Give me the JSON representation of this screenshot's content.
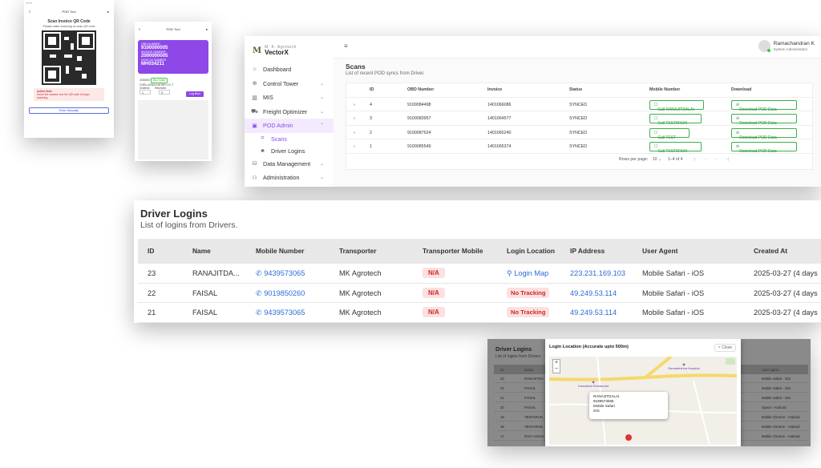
{
  "phone1": {
    "app_name": "POD Tool",
    "title": "Scan Invoice QR Code",
    "subtitle": "Please make scanning on scan QR code",
    "warning_title": "Action Note:",
    "warning_text": "Hover the camera over the QR code to begin scanning.",
    "enter_manually": "Enter Manually"
  },
  "phone2": {
    "app_name": "POD Tool",
    "card": {
      "l1": "OBD NUMBER",
      "v1": "9100000005",
      "l2": "INVOICE NUMBER",
      "v2": "2000000005",
      "l3": "VEHICLE NUMBER",
      "v3": "MH034211"
    },
    "info_id": "2000000",
    "badge": "Box Code",
    "company": "CHELLASWI KATHIR CO, T",
    "box_label_1": "Ordered",
    "box_label_2": "Received",
    "box_val_1": "1",
    "box_val_2": "0",
    "action": "Log Bind"
  },
  "vectorx": {
    "brand_top": "M. K. Agrotech",
    "brand": "VectorX",
    "user_name": "Ramachandran K",
    "user_role": "System Administrator",
    "nav": [
      {
        "label": "Dashboard",
        "icon": "⌂",
        "chevron": ""
      },
      {
        "label": "Control Tower",
        "icon": "⊕",
        "chevron": "⌄"
      },
      {
        "label": "MIS",
        "icon": "▥",
        "chevron": "⌄"
      },
      {
        "label": "Freight Optimizer",
        "icon": "⛟",
        "chevron": "⌄"
      },
      {
        "label": "POD Admin",
        "icon": "▣",
        "chevron": "⌃"
      },
      {
        "label": "Scans",
        "icon": "⌗",
        "chevron": ""
      },
      {
        "label": "Driver Logins",
        "icon": "♣",
        "chevron": ""
      },
      {
        "label": "Data Management",
        "icon": "⛁",
        "chevron": "⌄"
      },
      {
        "label": "Administration",
        "icon": "⚇",
        "chevron": "⌄"
      }
    ],
    "page_title": "Scans",
    "page_subtitle": "List of recent POD syncs from Driver.",
    "columns": [
      "ID",
      "OBD Number",
      "Invoice",
      "Status",
      "Mobile Number",
      "Download"
    ],
    "rows": [
      {
        "id": "4",
        "obd": "9100084498",
        "invoice": "1401066086",
        "status": "SYNCED",
        "call": "Call RANAJITDALAI",
        "download": "Download POD Data"
      },
      {
        "id": "3",
        "obd": "9100083957",
        "invoice": "1401064577",
        "status": "SYNCED",
        "call": "Call TESTARUN",
        "download": "Download POD Data"
      },
      {
        "id": "2",
        "obd": "9100087624",
        "invoice": "1401065240",
        "status": "SYNCED",
        "call": "Call TEST",
        "download": "Download POD Data"
      },
      {
        "id": "1",
        "obd": "9100085549",
        "invoice": "1401065374",
        "status": "SYNCED",
        "call": "Call TESTARUN",
        "download": "Download POD Data"
      }
    ],
    "rows_per_page_label": "Rows per page:",
    "rows_per_page": "10",
    "page_range": "1–4 of 4"
  },
  "driver_logins": {
    "title": "Driver Logins",
    "subtitle": "List of logins from Drivers.",
    "columns": [
      "ID",
      "Name",
      "Mobile Number",
      "Transporter",
      "Transporter Mobile",
      "Login Location",
      "IP Address",
      "User Agent",
      "Created At"
    ],
    "rows": [
      {
        "id": "23",
        "name": "RANAJITDA...",
        "mobile": "9439573065",
        "transporter": "MK Agrotech",
        "tmobile": "N/A",
        "location": "Login Map",
        "ip": "223.231.169.103",
        "agent": "Mobile Safari - iOS",
        "created": "2025-03-27 (4 days"
      },
      {
        "id": "22",
        "name": "FAISAL",
        "mobile": "9019850260",
        "transporter": "MK Agrotech",
        "tmobile": "N/A",
        "location": "No Tracking",
        "ip": "49.249.53.114",
        "agent": "Mobile Safari - iOS",
        "created": "2025-03-27 (4 days"
      },
      {
        "id": "21",
        "name": "FAISAL",
        "mobile": "9439573065",
        "transporter": "MK Agrotech",
        "tmobile": "N/A",
        "location": "No Tracking",
        "ip": "49.249.53.114",
        "agent": "Mobile Safari - iOS",
        "created": "2025-03-27 (4 days"
      }
    ]
  },
  "map_modal": {
    "bg_title": "Driver Logins",
    "bg_subtitle": "List of logins from Drivers",
    "bg_col_id": "ID",
    "bg_col_name": "Name",
    "bg_col_agent": "User Agent",
    "bg_rows": [
      {
        "id": "23",
        "name": "RANAJITDA",
        "agent": "Mobile Safari - iOS"
      },
      {
        "id": "22",
        "name": "FAISAL",
        "agent": "Mobile Safari - iOS"
      },
      {
        "id": "21",
        "name": "FAISAL",
        "agent": "Mobile Safari - iOS"
      },
      {
        "id": "20",
        "name": "FAISAL",
        "agent": "Opera - Android"
      },
      {
        "id": "19",
        "name": "TESTARUN",
        "agent": "Mobile Chrome - Android"
      },
      {
        "id": "18",
        "name": "TESTARUN",
        "agent": "Mobile Chrome - Android"
      },
      {
        "id": "17",
        "name": "RAVI YADAV",
        "agent": "Mobile Chrome - Android"
      }
    ],
    "title": "Login Location (Accurate upto 500m)",
    "close": "Close",
    "popup": [
      "RANAJITDALAI",
      "9439573065",
      "Mobile Safari",
      "iOS"
    ],
    "poi_1": "Kamakshi Restaurant",
    "poi_2": "Ramakrishna Hospital"
  }
}
